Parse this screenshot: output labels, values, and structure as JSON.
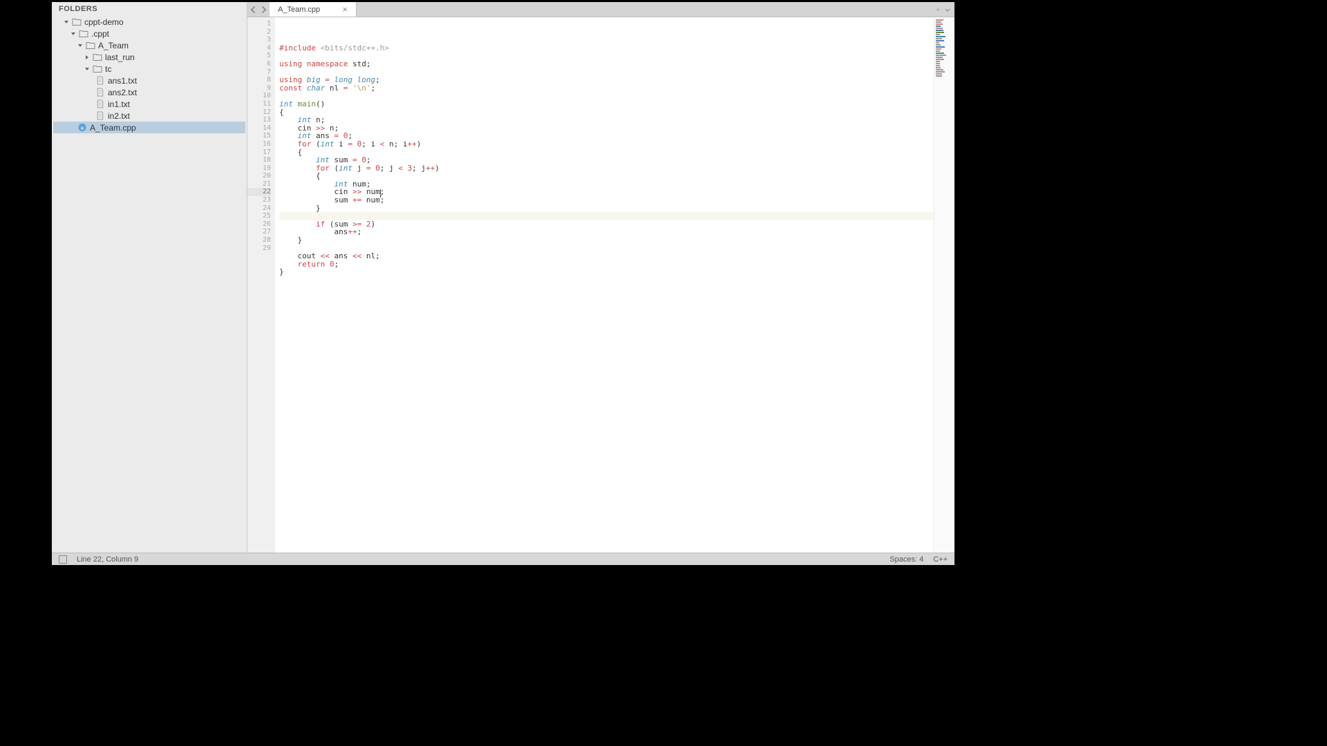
{
  "sidebar": {
    "header": "FOLDERS",
    "tree": [
      {
        "name": "cppt-demo",
        "type": "folder",
        "level": 1,
        "expanded": true
      },
      {
        "name": ".cppt",
        "type": "folder",
        "level": 2,
        "expanded": true
      },
      {
        "name": "A_Team",
        "type": "folder",
        "level": 3,
        "expanded": true
      },
      {
        "name": "last_run",
        "type": "folder",
        "level": 4,
        "expanded": false
      },
      {
        "name": "tc",
        "type": "folder",
        "level": 4,
        "expanded": true
      },
      {
        "name": "ans1.txt",
        "type": "file",
        "level": 5
      },
      {
        "name": "ans2.txt",
        "type": "file",
        "level": 5
      },
      {
        "name": "in1.txt",
        "type": "file",
        "level": 5
      },
      {
        "name": "in2.txt",
        "type": "file",
        "level": 5
      },
      {
        "name": "A_Team.cpp",
        "type": "cpp",
        "level": 3,
        "selected": true
      }
    ]
  },
  "tabs": {
    "active": "A_Team.cpp"
  },
  "code": {
    "lines": [
      {
        "n": 1,
        "html": "<span class='k-preproc'>#include</span> <span class='k-include'>&lt;bits/stdc++.h&gt;</span>"
      },
      {
        "n": 2,
        "html": ""
      },
      {
        "n": 3,
        "html": "<span class='k-keyword'>using</span> <span class='k-keyword'>namespace</span> std;"
      },
      {
        "n": 4,
        "html": ""
      },
      {
        "n": 5,
        "html": "<span class='k-keyword'>using</span> <span class='k-type'>big</span> <span class='k-op'>=</span> <span class='k-type'>long long</span>;"
      },
      {
        "n": 6,
        "html": "<span class='k-keyword'>const</span> <span class='k-type'>char</span> nl <span class='k-op'>=</span> <span class='k-str'>'\\n'</span>;"
      },
      {
        "n": 7,
        "html": ""
      },
      {
        "n": 8,
        "html": "<span class='k-type'>int</span> <span class='k-func'>main</span>()"
      },
      {
        "n": 9,
        "html": "{"
      },
      {
        "n": 10,
        "html": "    <span class='k-type'>int</span> n;"
      },
      {
        "n": 11,
        "html": "    cin <span class='k-op'>&gt;&gt;</span> n;"
      },
      {
        "n": 12,
        "html": "    <span class='k-type'>int</span> ans <span class='k-op'>=</span> <span class='k-num'>0</span>;"
      },
      {
        "n": 13,
        "html": "    <span class='k-keyword'>for</span> (<span class='k-type'>int</span> i <span class='k-op'>=</span> <span class='k-num'>0</span>; i <span class='k-op'>&lt;</span> n; i<span class='k-op'>++</span>)"
      },
      {
        "n": 14,
        "html": "    {"
      },
      {
        "n": 15,
        "html": "        <span class='k-type'>int</span> sum <span class='k-op'>=</span> <span class='k-num'>0</span>;"
      },
      {
        "n": 16,
        "html": "        <span class='k-keyword'>for</span> (<span class='k-type'>int</span> j <span class='k-op'>=</span> <span class='k-num'>0</span>; j <span class='k-op'>&lt;</span> <span class='k-num'>3</span>; j<span class='k-op'>++</span>)"
      },
      {
        "n": 17,
        "html": "        {"
      },
      {
        "n": 18,
        "html": "            <span class='k-type'>int</span> num;"
      },
      {
        "n": 19,
        "html": "            cin <span class='k-op'>&gt;&gt;</span> num;"
      },
      {
        "n": 20,
        "html": "            sum <span class='k-op'>+=</span> num;"
      },
      {
        "n": 21,
        "html": "        }"
      },
      {
        "n": 22,
        "html": "        ",
        "current": true
      },
      {
        "n": 23,
        "html": "        <span class='k-keyword'>if</span> (sum <span class='k-op'>&gt;=</span> <span class='k-num'>2</span>)"
      },
      {
        "n": 24,
        "html": "            ans<span class='k-op'>++</span>;"
      },
      {
        "n": 25,
        "html": "    }"
      },
      {
        "n": 26,
        "html": ""
      },
      {
        "n": 27,
        "html": "    cout <span class='k-op'>&lt;&lt;</span> ans <span class='k-op'>&lt;&lt;</span> nl;"
      },
      {
        "n": 28,
        "html": "    <span class='k-keyword'>return</span> <span class='k-num'>0</span>;"
      },
      {
        "n": 29,
        "html": "}"
      }
    ]
  },
  "status": {
    "cursor": "Line 22, Column 9",
    "spaces": "Spaces: 4",
    "lang": "C++"
  },
  "minimap_colors": [
    "#c88",
    "#999",
    "#c88",
    "#48a",
    "#c88",
    "#48a",
    "#6a8a3a",
    "#999",
    "#48a",
    "#999",
    "#48a",
    "#c88",
    "#999",
    "#48a",
    "#c88",
    "#999",
    "#48a",
    "#999",
    "#999",
    "#999",
    "#999",
    "#c88",
    "#999",
    "#999",
    "#999",
    "#999",
    "#c88",
    "#999"
  ]
}
